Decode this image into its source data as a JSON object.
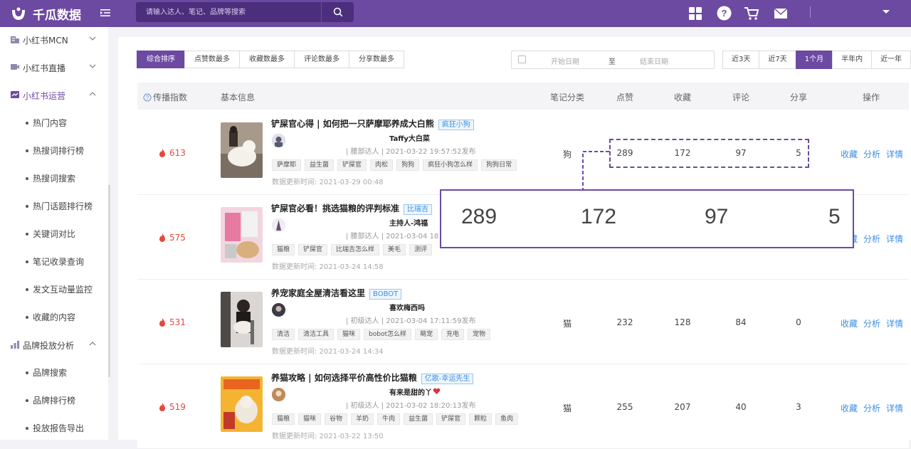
{
  "app": {
    "name": "千瓜数据"
  },
  "search": {
    "placeholder": "请输入达人、笔记、品牌等搜索"
  },
  "sidebar": {
    "groups": [
      {
        "label": "小红书MCN",
        "icon": "building-icon"
      },
      {
        "label": "小红书直播",
        "icon": "video-icon"
      },
      {
        "label": "小红书运营",
        "icon": "operation-icon"
      },
      {
        "label": "品牌投放分析",
        "icon": "chart-icon"
      }
    ],
    "items": [
      "热门内容",
      "热搜词排行榜",
      "热搜词搜索",
      "热门话题排行榜",
      "关键词对比",
      "笔记收录查询",
      "发文互动量监控",
      "收藏的内容"
    ],
    "brand_items": [
      "品牌搜索",
      "品牌排行榜",
      "投放报告导出"
    ]
  },
  "sort_tabs": [
    "综合排序",
    "点赞数最多",
    "收藏数最多",
    "评论数最多",
    "分享数最多"
  ],
  "date_range": {
    "start_placeholder": "开始日期",
    "separator": "至",
    "end_placeholder": "结束日期"
  },
  "periods": [
    "近3天",
    "近7天",
    "1个月",
    "半年内",
    "近一年"
  ],
  "table": {
    "headers": {
      "index": "传播指数",
      "info": "基本信息",
      "category": "笔记分类",
      "likes": "点赞",
      "collects": "收藏",
      "comments": "评论",
      "shares": "分享",
      "actions": "操作"
    },
    "actions": [
      "收藏",
      "分析",
      "详情"
    ],
    "rows": [
      {
        "index": "613",
        "title": "铲屎官心得 | 如何把一只萨摩耶养成大白熊",
        "tag": "疯狂小狗",
        "author": "Taffy大白菜",
        "meta": "| 腰部达人  | 2021-03-22 19:57:52发布",
        "chips": [
          "萨摩耶",
          "益生菌",
          "铲屎官",
          "肉松",
          "狗狗",
          "疯狂小狗怎么样",
          "狗狗日常"
        ],
        "updated": "数据更新时间:  2021-03-29 00:48",
        "category": "狗",
        "likes": "289",
        "collects": "172",
        "comments": "97",
        "shares": "5"
      },
      {
        "index": "575",
        "title": "铲屎官必看！挑选猫粮的评判标准",
        "tag": "比瑞吉",
        "author": "主持人-鸿福",
        "meta": "| 腰部达人  | 2021-03-04 18",
        "chips": [
          "猫粮",
          "铲屎官",
          "比瑞吉怎么样",
          "美毛",
          "测评"
        ],
        "updated": "数据更新时间:  2021-03-24 14:58",
        "category": "",
        "likes": "",
        "collects": "",
        "comments": "",
        "shares": ""
      },
      {
        "index": "531",
        "title": "养宠家庭全屋清洁看这里",
        "tag": "BOBOT",
        "author": "喜欢梅西吗",
        "meta": "| 初级达人  | 2021-03-04 17:11:59发布",
        "chips": [
          "清洁",
          "清洁工具",
          "猫咪",
          "bobot怎么样",
          "萌宠",
          "充电",
          "宠物"
        ],
        "updated": "数据更新时间:  2021-03-24 14:34",
        "category": "猫",
        "likes": "232",
        "collects": "128",
        "comments": "84",
        "shares": "0"
      },
      {
        "index": "519",
        "title": "养猫攻略 | 如何选择平价高性价比猫粮",
        "tag": "亿歌-幸运先生",
        "author": "有来是甜的丫",
        "meta": "| 初级达人  | 2021-03-02 18:20:13发布",
        "chips": [
          "猫粮",
          "猫咪",
          "谷物",
          "羊奶",
          "牛肉",
          "益生菌",
          "铲屎官",
          "颗粒",
          "鱼肉"
        ],
        "updated": "数据更新时间:  2021-03-22 13:50",
        "category": "猫",
        "likes": "255",
        "collects": "207",
        "comments": "40",
        "shares": "3"
      }
    ]
  },
  "zoom": {
    "likes": "289",
    "collects": "172",
    "comments": "97",
    "shares": "5"
  },
  "colors": {
    "brand": "#6c4aa1",
    "link": "#3b8fe0",
    "hot": "#e24a3b"
  }
}
